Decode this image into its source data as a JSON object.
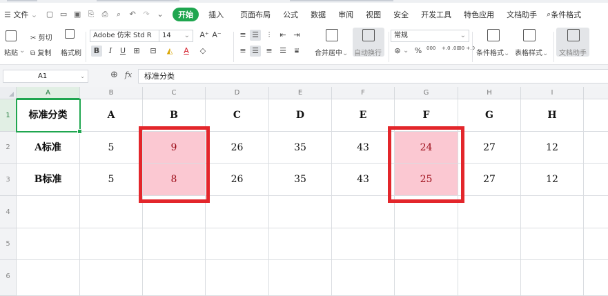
{
  "menubar": {
    "file_label": "文件",
    "tabs": [
      "开始",
      "插入",
      "页面布局",
      "公式",
      "数据",
      "审阅",
      "视图",
      "安全",
      "开发工具",
      "特色应用",
      "文档助手"
    ],
    "search_label": "条件格式"
  },
  "ribbon": {
    "paste_label": "粘贴",
    "cut_label": "剪切",
    "copy_label": "复制",
    "format_painter_label": "格式刷",
    "font_name": "Adobe 仿宋 Std R",
    "font_size": "14",
    "merge_center_label": "合并居中",
    "auto_wrap_label": "自动换行",
    "number_format": "常规",
    "percent_symbol": "%",
    "thousands_symbol": "000",
    "inc_decimal_label": "+.0 .00",
    "dec_decimal_label": ".00 +.0",
    "cond_format_label": "条件格式",
    "table_style_label": "表格样式",
    "doc_helper_label": "文档助手"
  },
  "formula_bar": {
    "cell_ref": "A1",
    "fx_label": "fx",
    "content": "标准分类"
  },
  "grid": {
    "col_headers": [
      "A",
      "B",
      "C",
      "D",
      "E",
      "F",
      "G",
      "H",
      "I"
    ],
    "row_headers": [
      "1",
      "2",
      "3",
      "4",
      "5",
      "6"
    ],
    "rows": [
      [
        "标准分类",
        "A",
        "B",
        "C",
        "D",
        "E",
        "F",
        "G",
        "H"
      ],
      [
        "A标准",
        "5",
        "9",
        "26",
        "35",
        "43",
        "24",
        "27",
        "12"
      ],
      [
        "B标准",
        "5",
        "8",
        "26",
        "35",
        "43",
        "25",
        "27",
        "12"
      ]
    ]
  },
  "colors": {
    "accent": "#1fa64f",
    "highlight_fill": "#fbc8d2",
    "highlight_text": "#9b0a16",
    "annotation_box": "#e3262b"
  }
}
